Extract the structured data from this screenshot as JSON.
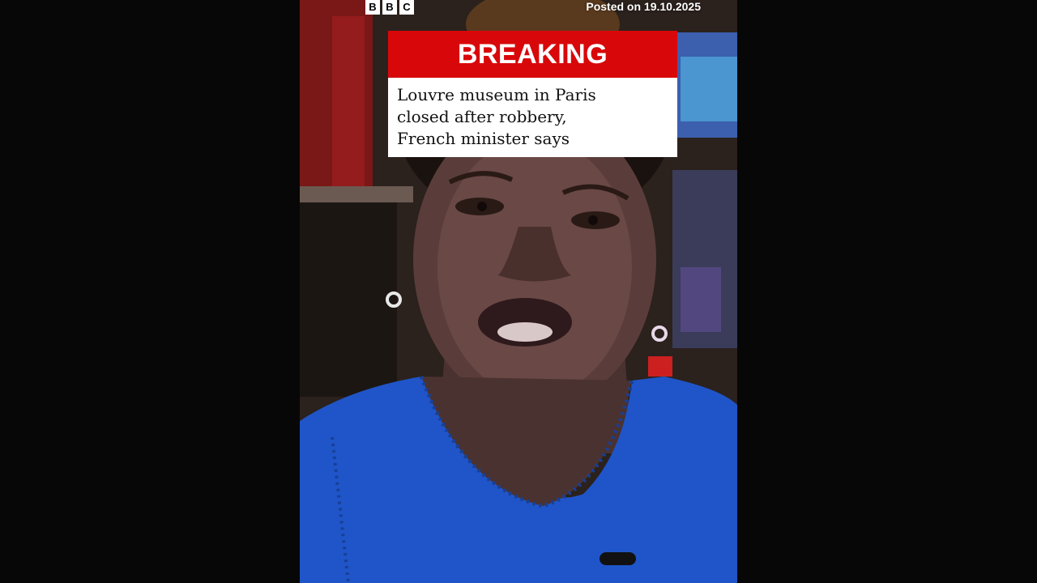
{
  "brand": {
    "logo_letters": [
      "B",
      "B",
      "C"
    ]
  },
  "posted_label": "Posted on 19.10.2025",
  "breaking": {
    "label": "BREAKING",
    "headline_lines": [
      "Louvre museum in Paris",
      "closed after robbery,",
      "French minister says"
    ]
  },
  "colors": {
    "breaking_red": "#d8080a",
    "dress_blue": "#1f55c8"
  }
}
